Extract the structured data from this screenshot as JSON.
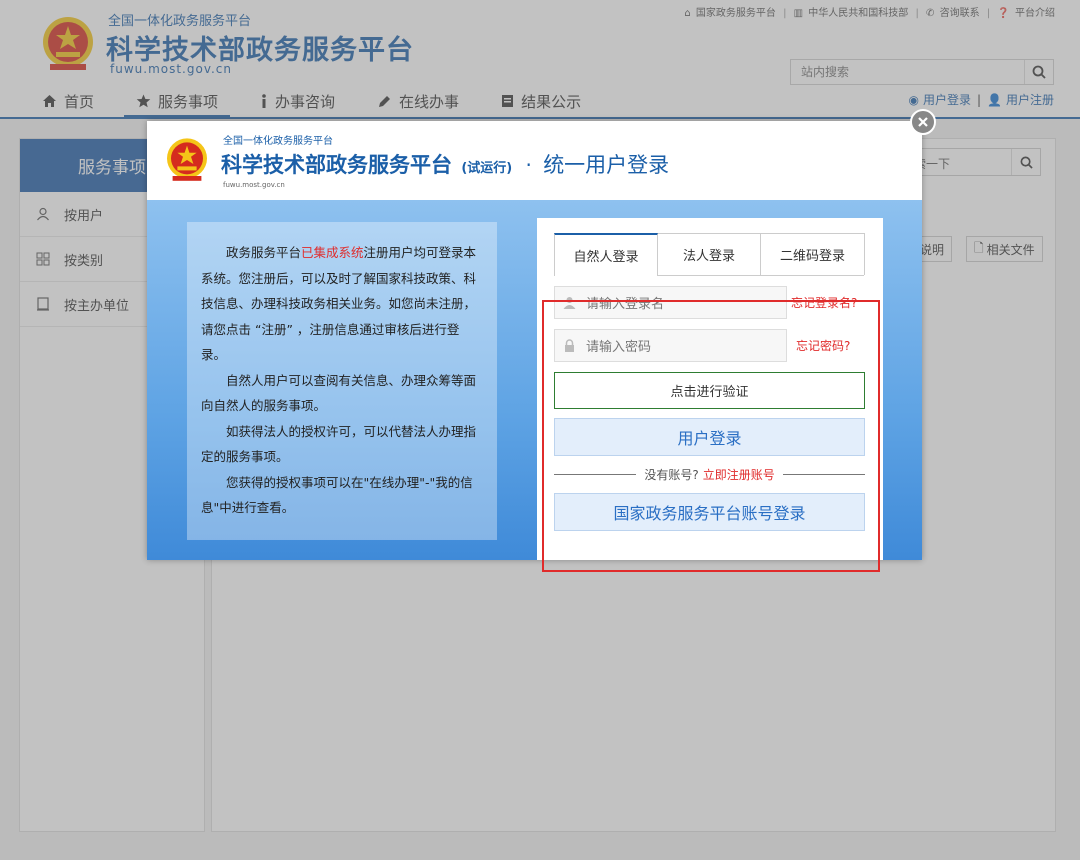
{
  "header": {
    "subtitle": "全国一体化政务服务平台",
    "title": "科学技术部政务服务平台",
    "url": "fuwu.most.gov.cn",
    "top_links": [
      "国家政务服务平台",
      "中华人民共和国科技部",
      "咨询联系",
      "平台介绍"
    ],
    "search_placeholder": "站内搜索",
    "user_login": "用户登录",
    "user_register": "用户注册",
    "nav": [
      "首页",
      "服务事项",
      "办事咨询",
      "在线办事",
      "结果公示"
    ]
  },
  "sidebar": {
    "title": "服务事项",
    "items": [
      "按用户",
      "按类别",
      "按主办单位"
    ]
  },
  "main": {
    "search_button_text": "检索一下",
    "btn_explain": "说明",
    "btn_docs": "相关文件"
  },
  "modal": {
    "sub": "全国一体化政务服务平台",
    "title": "科学技术部政务服务平台",
    "trial": "(试运行)",
    "separator": "·",
    "unified": "统一用户登录",
    "url": "fuwu.most.gov.cn",
    "intro_p1_a": "政务服务平台",
    "intro_p1_red": "已集成系统",
    "intro_p1_b": "注册用户均可登录本系统。您注册后，可以及时了解国家科技政策、科技信息、办理科技政务相关业务。如您尚未注册，请您点击 “注册” ，注册信息通过审核后进行登录。",
    "intro_p2": "自然人用户可以查阅有关信息、办理众筹等面向自然人的服务事项。",
    "intro_p3": "如获得法人的授权许可，可以代替法人办理指定的服务事项。",
    "intro_p4": "您获得的授权事项可以在\"在线办理\"-\"我的信息\"中进行查看。",
    "tabs": [
      "自然人登录",
      "法人登录",
      "二维码登录"
    ],
    "username_placeholder": "请输入登录名",
    "password_placeholder": "请输入密码",
    "forgot_username": "忘记登录名?",
    "forgot_password": "忘记密码?",
    "verify": "点击进行验证",
    "login": "用户登录",
    "no_account": "没有账号?",
    "register_now": "立即注册账号",
    "gov_login": "国家政务服务平台账号登录"
  },
  "colors": {
    "brand_blue": "#1b5fa8",
    "alert_red": "#e02b2b",
    "emblem_red": "#d52b1e",
    "emblem_gold": "#f5c518"
  }
}
